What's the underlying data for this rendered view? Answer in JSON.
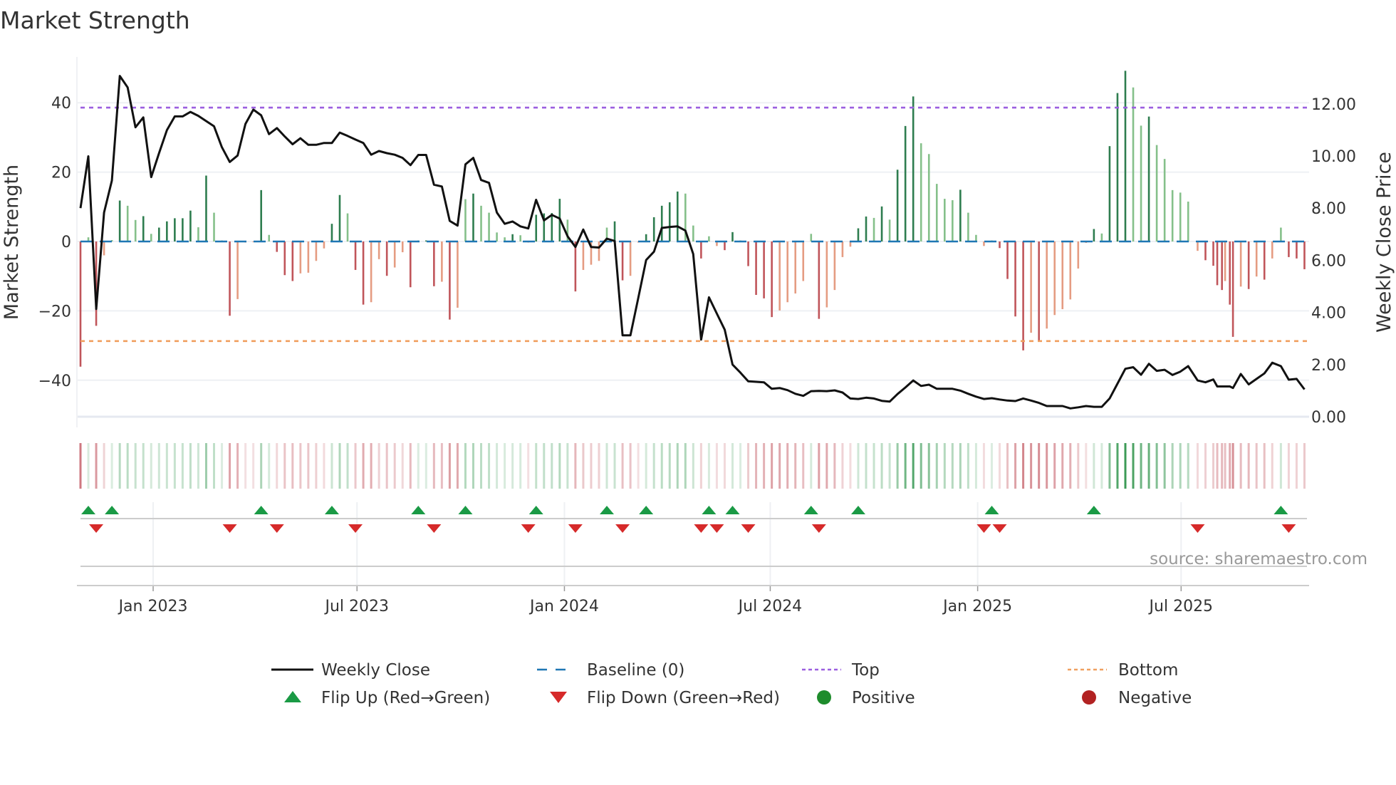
{
  "chart_data": {
    "type": "bar",
    "title": "Market Strength",
    "ylabel": "Market Strength",
    "y2label": "Weekly Close Price",
    "ylim": [
      -53,
      53
    ],
    "y2lim": [
      0,
      13.8
    ],
    "yticks": [
      "40",
      "20",
      "0",
      "−20",
      "−40"
    ],
    "ytick_values": [
      40,
      20,
      0,
      -20,
      -40
    ],
    "y2ticks": [
      "12.00",
      "10.00",
      "8.00",
      "6.00",
      "4.00",
      "2.00",
      "0.00"
    ],
    "y2tick_values": [
      12,
      10,
      8,
      6,
      4,
      2,
      0
    ],
    "xticks": [
      {
        "label": "Jan 2023",
        "week": 9.25
      },
      {
        "label": "Jul 2023",
        "week": 35.2
      },
      {
        "label": "Jan 2024",
        "week": 61.6
      },
      {
        "label": "Jul 2024",
        "week": 87.8
      },
      {
        "label": "Jan 2025",
        "week": 114.2
      },
      {
        "label": "Jul 2025",
        "week": 140.1
      }
    ],
    "top_level": 38.6,
    "bottom_level": -28.7,
    "baseline": 0,
    "week": [
      0,
      1,
      2,
      3,
      4,
      5,
      6,
      7,
      8,
      9,
      10,
      11,
      12,
      13,
      14,
      15,
      16,
      17,
      18,
      19,
      20,
      21,
      22,
      23,
      24,
      25,
      26,
      27,
      28,
      29,
      30,
      31,
      32,
      33,
      34,
      35,
      36,
      37,
      38,
      39,
      40,
      41,
      42,
      43,
      44,
      45,
      46,
      47,
      48,
      49,
      50,
      51,
      52,
      53,
      54,
      55,
      56,
      57,
      58,
      59,
      60,
      61,
      62,
      63,
      64,
      65,
      66,
      67,
      68,
      69,
      70,
      71,
      72,
      73,
      74,
      75,
      76,
      77,
      78,
      79,
      80,
      81,
      82,
      83,
      84,
      85,
      86,
      87,
      88,
      89,
      90,
      91,
      92,
      93,
      94,
      95,
      96,
      97,
      98,
      99,
      100,
      101,
      102,
      103,
      104,
      105,
      106,
      107,
      108,
      109,
      110,
      111,
      112,
      113,
      114,
      115,
      116,
      117,
      118,
      119,
      120,
      121,
      122,
      123,
      124,
      125,
      126,
      127,
      128,
      129,
      130,
      131,
      132,
      133,
      134,
      135,
      136,
      137,
      138,
      139,
      140,
      141,
      142.2,
      143.2,
      144.2,
      144.7,
      145.3,
      145.7,
      146.3,
      146.7,
      147.7,
      148.7,
      149.7,
      150.7,
      151.7,
      152.8,
      153.8,
      154.8,
      155.8
    ],
    "strength": [
      -36.1,
      1.2,
      -24.3,
      -4,
      0.4,
      11.8,
      10.3,
      6.2,
      7.3,
      2.2,
      4,
      5.8,
      6.7,
      6.7,
      8.9,
      4.1,
      19,
      8.3,
      0.3,
      -21.4,
      -16.6,
      -0.3,
      -0.2,
      14.8,
      1.9,
      -3,
      -9.7,
      -11.4,
      -9.2,
      -9,
      -5.6,
      -2,
      5.1,
      13.4,
      8.1,
      -8.2,
      -18.2,
      -17.5,
      -5.1,
      -9.9,
      -7.5,
      -3.1,
      -13.2,
      0.3,
      0.3,
      -12.9,
      -11.6,
      -22.5,
      -19.1,
      12.2,
      13.8,
      10.3,
      8.3,
      2.6,
      1.2,
      2.1,
      1.8,
      -0.3,
      7.7,
      8.1,
      8.2,
      12.3,
      6.3,
      -14.4,
      -8.2,
      -6.7,
      -5.6,
      4,
      5.8,
      -11.2,
      -9.9,
      -0.3,
      2.1,
      7,
      10.3,
      11.3,
      14.4,
      13.8,
      4.6,
      -4.9,
      1.5,
      -1.3,
      -2.5,
      2.7,
      0.3,
      -7.1,
      -15.4,
      -16.4,
      -21.8,
      -19.9,
      -17.5,
      -15,
      -11.4,
      2.2,
      -22.3,
      -19,
      -14,
      -4.5,
      -1.5,
      3.8,
      7.2,
      6.8,
      10.1,
      6.3,
      20.7,
      33.3,
      41.8,
      28.3,
      25.2,
      16.6,
      12.3,
      11.9,
      14.9,
      8.3,
      1.9,
      -1.3,
      0.3,
      -1.9,
      -10.8,
      -21.6,
      -31.4,
      -26.3,
      -28.6,
      -25.1,
      -21.2,
      -19.5,
      -16.7,
      -7.8,
      -0.4,
      3.6,
      2.3,
      27.5,
      42.8,
      49.2,
      44.4,
      33.4,
      36,
      27.8,
      23.8,
      14.8,
      14.1,
      11.5,
      -2.7,
      -5.4,
      -7,
      -12.6,
      -14,
      -11.4,
      -18.2,
      -27.5,
      -13,
      -13.7,
      -10.1,
      -11,
      -4.9,
      4,
      -4.5,
      -4.9,
      -8
    ],
    "close": [
      8.0,
      9.99,
      4.13,
      7.83,
      9.06,
      13.07,
      12.63,
      11.1,
      11.48,
      9.19,
      10.11,
      10.99,
      11.52,
      11.52,
      11.69,
      11.54,
      11.34,
      11.14,
      10.34,
      9.77,
      10.02,
      11.23,
      11.78,
      11.56,
      10.84,
      11.07,
      10.75,
      10.45,
      10.68,
      10.43,
      10.43,
      10.5,
      10.5,
      10.9,
      10.77,
      10.63,
      10.5,
      10.05,
      10.19,
      10.11,
      10.05,
      9.93,
      9.65,
      10.04,
      10.04,
      8.9,
      8.83,
      7.51,
      7.33,
      9.68,
      9.93,
      9.08,
      8.97,
      7.83,
      7.4,
      7.49,
      7.3,
      7.22,
      8.32,
      7.53,
      7.74,
      7.6,
      6.92,
      6.51,
      7.18,
      6.51,
      6.49,
      6.83,
      6.74,
      3.12,
      3.12,
      4.55,
      6.01,
      6.33,
      7.24,
      7.28,
      7.3,
      7.14,
      6.24,
      2.96,
      4.58,
      3.96,
      3.34,
      2.0,
      1.69,
      1.36,
      1.34,
      1.32,
      1.07,
      1.1,
      1.02,
      0.88,
      0.8,
      0.98,
      0.99,
      0.98,
      1.01,
      0.93,
      0.7,
      0.68,
      0.73,
      0.7,
      0.61,
      0.58,
      0.87,
      1.12,
      1.39,
      1.18,
      1.23,
      1.07,
      1.07,
      1.07,
      1.0,
      0.88,
      0.77,
      0.68,
      0.71,
      0.66,
      0.62,
      0.6,
      0.7,
      0.62,
      0.53,
      0.41,
      0.41,
      0.41,
      0.32,
      0.36,
      0.41,
      0.38,
      0.38,
      0.7,
      1.27,
      1.84,
      1.9,
      1.61,
      2.03,
      1.76,
      1.8,
      1.6,
      1.73,
      1.94,
      1.39,
      1.32,
      1.43,
      1.16,
      1.16,
      1.16,
      1.16,
      1.1,
      1.64,
      1.24,
      1.45,
      1.66,
      2.07,
      1.94,
      1.42,
      1.45,
      1.05
    ],
    "flip_up_weeks": [
      1,
      4,
      23,
      32,
      43,
      49,
      58,
      67,
      72,
      80,
      83,
      93,
      99,
      116,
      129,
      152.8
    ],
    "flip_down_weeks": [
      2,
      19,
      25,
      35,
      45,
      57,
      63,
      69,
      79,
      81,
      85,
      94,
      115,
      117,
      142.2,
      153.8
    ],
    "legend": {
      "placement": "bottom",
      "items": [
        "Weekly Close",
        "Baseline (0)",
        "Top",
        "Bottom",
        "Flip Up (Red→Green)",
        "Flip Down (Green→Red)",
        "Positive",
        "Negative"
      ]
    },
    "source": "source: sharemaestro.com"
  },
  "colors": {
    "close": "#111111",
    "baseline": "#1f77b4",
    "top": "#9b5fe0",
    "bottom": "#f0a060",
    "pos_strong": "#2e7d4f",
    "pos_weak": "#85c08a",
    "neg_strong": "#c0555a",
    "neg_weak": "#e59c82",
    "flip_up": "#1a9a45",
    "flip_down": "#d62a2a",
    "positive": "#1e8c2c",
    "negative": "#b22222"
  }
}
